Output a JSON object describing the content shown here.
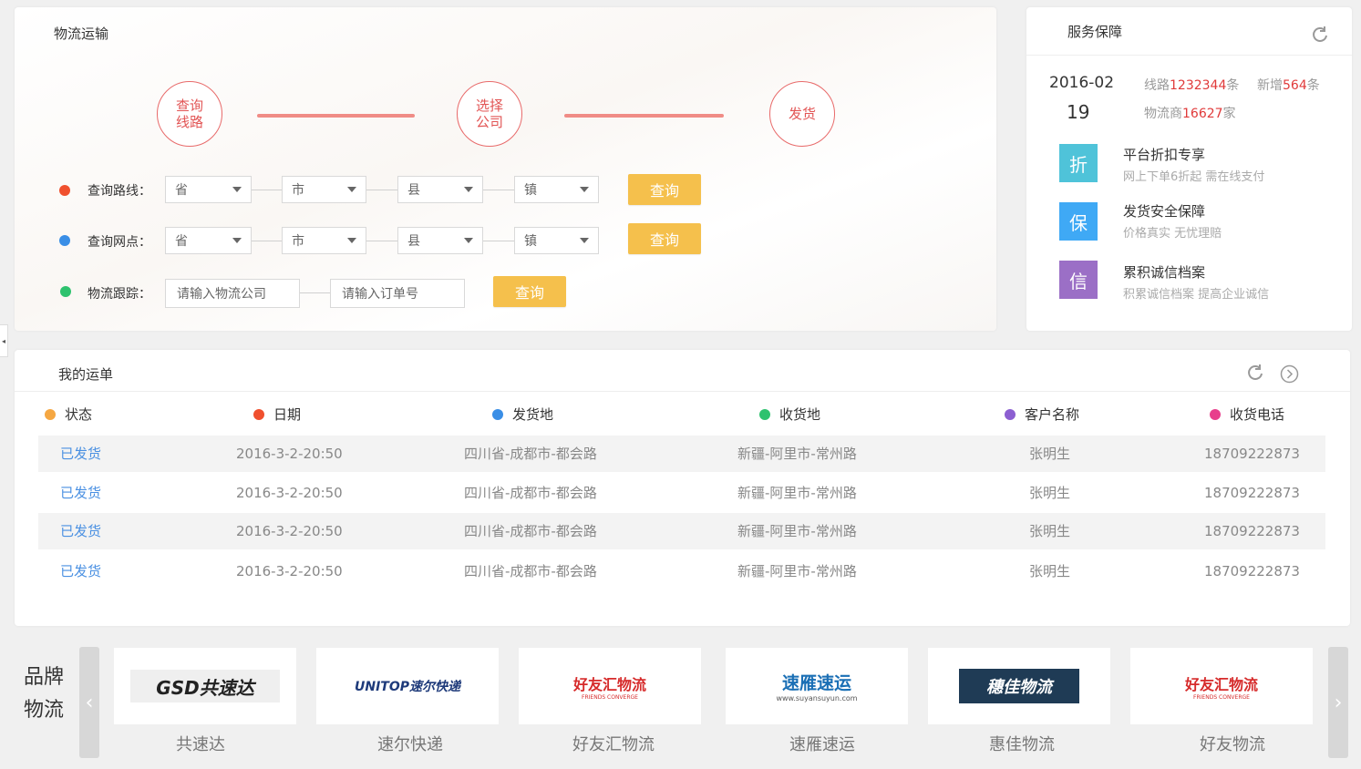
{
  "logistics": {
    "title": "物流运输",
    "steps": [
      "查询\n线路",
      "选择\n公司",
      "发货"
    ],
    "route_row": {
      "label": "查询路线：",
      "selects": [
        "省",
        "市",
        "县",
        "镇"
      ],
      "button": "查询"
    },
    "outlet_row": {
      "label": "查询网点：",
      "selects": [
        "省",
        "市",
        "县",
        "镇"
      ],
      "button": "查询"
    },
    "tracking_row": {
      "label": "物流跟踪：",
      "company_placeholder": "请输入物流公司",
      "order_placeholder": "请输入订单号",
      "button": "查询"
    }
  },
  "service": {
    "title": "服务保障",
    "date_ym": "2016-02",
    "date_d": "19",
    "stats": {
      "routes_prefix": "线路",
      "routes_value": "1232344",
      "routes_suffix": "条",
      "new_prefix": "新增",
      "new_value": "564",
      "new_suffix": "条",
      "carriers_prefix": "物流商",
      "carriers_value": "16627",
      "carriers_suffix": "家"
    },
    "items": [
      {
        "icon": "折",
        "color": "#4fc3d9",
        "title": "平台折扣专享",
        "sub": "网上下单6折起   需在线支付"
      },
      {
        "icon": "保",
        "color": "#3fa9f5",
        "title": "发货安全保障",
        "sub": "价格真实   无忧理赔"
      },
      {
        "icon": "信",
        "color": "#9b6fc6",
        "title": "累积诚信档案",
        "sub": "积累诚信档案   提高企业诚信"
      }
    ]
  },
  "waybill": {
    "title": "我的运单",
    "columns": [
      {
        "label": "状态",
        "color": "#f5a742"
      },
      {
        "label": "日期",
        "color": "#f0502e"
      },
      {
        "label": "发货地",
        "color": "#3a8ee6"
      },
      {
        "label": "收货地",
        "color": "#2ec26e"
      },
      {
        "label": "客户名称",
        "color": "#8c5fd1"
      },
      {
        "label": "收货电话",
        "color": "#e83e8c"
      }
    ],
    "rows": [
      [
        "已发货",
        "2016-3-2-20:50",
        "四川省-成都市-都会路",
        "新疆-阿里市-常州路",
        "张明生",
        "18709222873"
      ],
      [
        "已发货",
        "2016-3-2-20:50",
        "四川省-成都市-都会路",
        "新疆-阿里市-常州路",
        "张明生",
        "18709222873"
      ],
      [
        "已发货",
        "2016-3-2-20:50",
        "四川省-成都市-都会路",
        "新疆-阿里市-常州路",
        "张明生",
        "18709222873"
      ],
      [
        "已发货",
        "2016-3-2-20:50",
        "四川省-成都市-都会路",
        "新疆-阿里市-常州路",
        "张明生",
        "18709222873"
      ]
    ]
  },
  "brands": {
    "title": "品牌物流",
    "prev": "‹",
    "next": "›",
    "items": [
      {
        "logo": "GSD共速达",
        "name": "共速达"
      },
      {
        "logo": "UNITOP速尔快递",
        "name": "速尔快递"
      },
      {
        "logo": "好友汇物流",
        "logo_sub": "FRIENDS CONVERGE",
        "name": "好友汇物流"
      },
      {
        "logo": "速雁速运",
        "logo_sub": "www.suyansuyun.com",
        "name": "速雁速运"
      },
      {
        "logo": "穗佳物流",
        "name": "惠佳物流"
      },
      {
        "logo": "好友汇物流",
        "logo_sub": "FRIENDS CONVERGE",
        "name": "好友物流"
      }
    ]
  },
  "side_tab": "◂"
}
